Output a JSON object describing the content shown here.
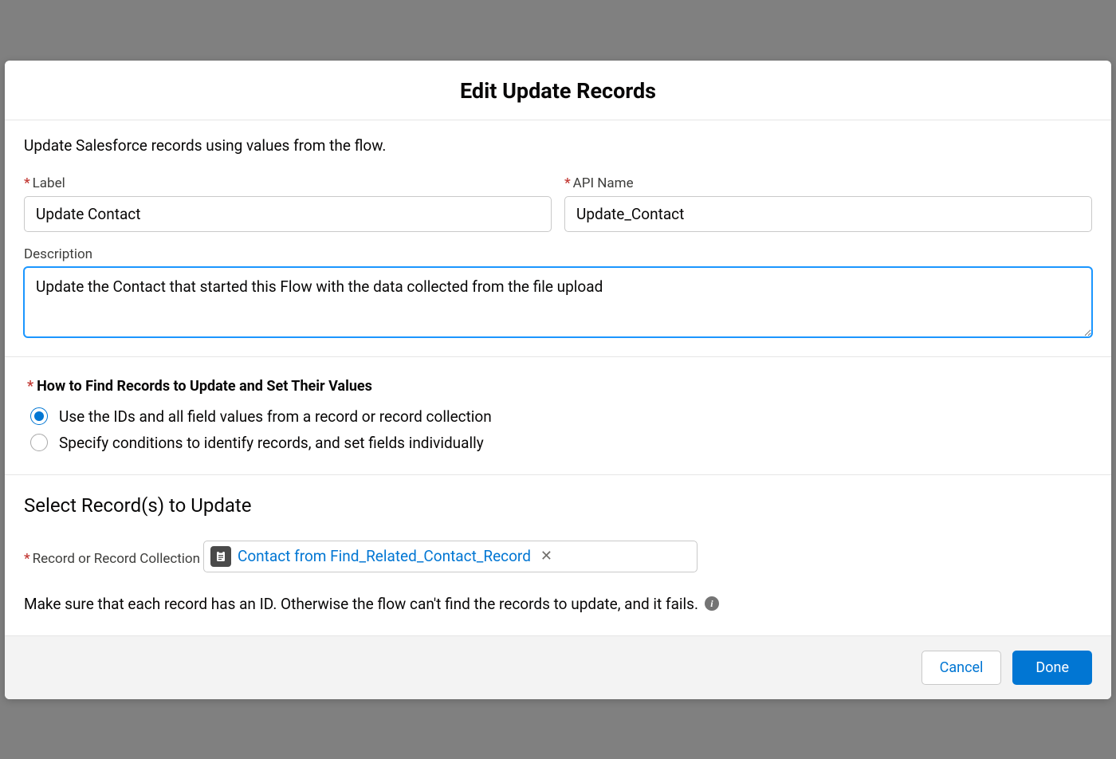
{
  "modal": {
    "title": "Edit Update Records"
  },
  "intro": "Update Salesforce records using values from the flow.",
  "fields": {
    "label": {
      "label": "Label",
      "value": "Update Contact"
    },
    "apiName": {
      "label": "API Name",
      "value": "Update_Contact"
    },
    "description": {
      "label": "Description",
      "value": "Update the Contact that started this Flow with the data collected from the file upload"
    }
  },
  "findRecords": {
    "heading": "How to Find Records to Update and Set Their Values",
    "options": [
      {
        "label": "Use the IDs and all field values from a record or record collection",
        "selected": true
      },
      {
        "label": "Specify conditions to identify records, and set fields individually",
        "selected": false
      }
    ]
  },
  "selectRecords": {
    "heading": "Select Record(s) to Update",
    "fieldLabel": "Record or Record Collection",
    "pillText": "Contact from Find_Related_Contact_Record",
    "helper": "Make sure that each record has an ID. Otherwise the flow can't find the records to update, and it fails."
  },
  "footer": {
    "cancel": "Cancel",
    "done": "Done"
  }
}
